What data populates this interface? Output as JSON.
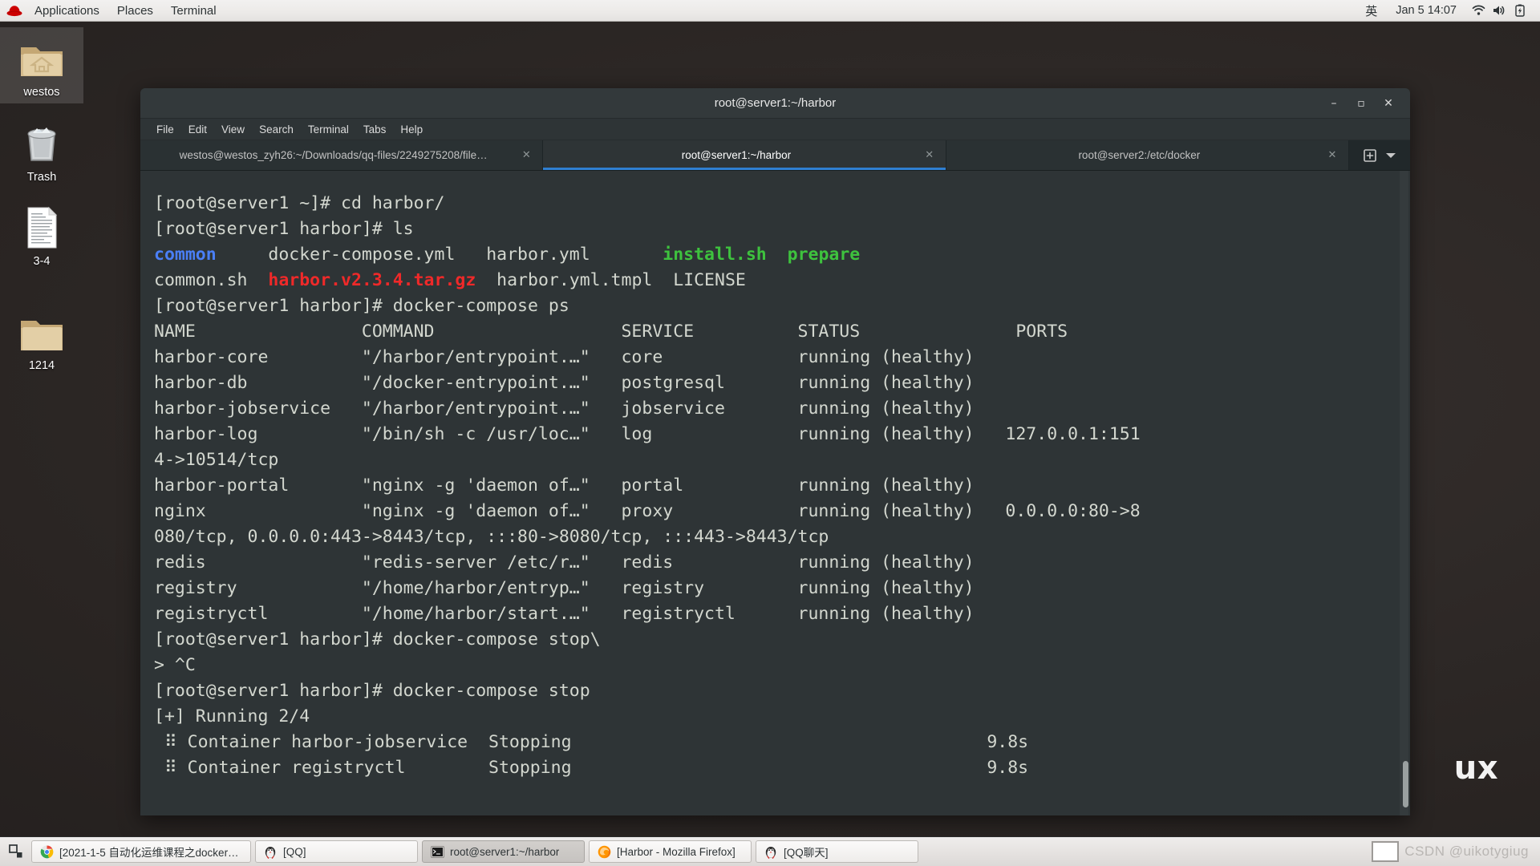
{
  "top_panel": {
    "logo_icon": "redhat-logo-icon",
    "menus": [
      "Applications",
      "Places",
      "Terminal"
    ],
    "input_method": "英",
    "clock": "Jan 5  14:07",
    "tray_icons": [
      "wifi-icon",
      "volume-icon",
      "battery-icon"
    ]
  },
  "desktop": {
    "wallpaper_text": "ux",
    "icons": [
      {
        "label": "westos",
        "icon": "home-folder-icon",
        "selected": true
      },
      {
        "label": "Trash",
        "icon": "trash-icon",
        "selected": false
      },
      {
        "label": "3-4",
        "icon": "document-icon",
        "selected": false
      },
      {
        "label": "1214",
        "icon": "folder-icon",
        "selected": false
      }
    ]
  },
  "terminal": {
    "title": "root@server1:~/harbor",
    "window_buttons": {
      "minimize": "–",
      "maximize": "▫",
      "close": "✕"
    },
    "menu": [
      "File",
      "Edit",
      "View",
      "Search",
      "Terminal",
      "Tabs",
      "Help"
    ],
    "tabs": [
      {
        "label": "westos@westos_zyh26:~/Downloads/qq-files/2249275208/file…",
        "active": false,
        "close": "✕"
      },
      {
        "label": "root@server1:~/harbor",
        "active": true,
        "close": "✕"
      },
      {
        "label": "root@server2:/etc/docker",
        "active": false,
        "close": "✕"
      }
    ],
    "tab_extras": {
      "new_tab_icon": "new-tab-icon",
      "dropdown_icon": "chevron-down-icon"
    },
    "content_lines": [
      {
        "segments": [
          {
            "text": "[root@server1 ~]# cd harbor/",
            "color": "default"
          }
        ]
      },
      {
        "segments": [
          {
            "text": "[root@server1 harbor]# ls",
            "color": "default"
          }
        ]
      },
      {
        "segments": [
          {
            "text": "common",
            "color": "blue"
          },
          {
            "text": "     docker-compose.yml   harbor.yml       ",
            "color": "default"
          },
          {
            "text": "install.sh",
            "color": "green"
          },
          {
            "text": "  ",
            "color": "default"
          },
          {
            "text": "prepare",
            "color": "green"
          }
        ]
      },
      {
        "segments": [
          {
            "text": "common.sh  ",
            "color": "default"
          },
          {
            "text": "harbor.v2.3.4.tar.gz",
            "color": "red"
          },
          {
            "text": "  harbor.yml.tmpl  LICENSE",
            "color": "default"
          }
        ]
      },
      {
        "segments": [
          {
            "text": "[root@server1 harbor]# docker-compose ps",
            "color": "default"
          }
        ]
      },
      {
        "segments": [
          {
            "text": "NAME                COMMAND                  SERVICE          STATUS               PORTS",
            "color": "default"
          }
        ]
      },
      {
        "segments": [
          {
            "text": "harbor-core         \"/harbor/entrypoint.…\"   core             running (healthy)",
            "color": "default"
          }
        ]
      },
      {
        "segments": [
          {
            "text": "harbor-db           \"/docker-entrypoint.…\"   postgresql       running (healthy)",
            "color": "default"
          }
        ]
      },
      {
        "segments": [
          {
            "text": "harbor-jobservice   \"/harbor/entrypoint.…\"   jobservice       running (healthy)",
            "color": "default"
          }
        ]
      },
      {
        "segments": [
          {
            "text": "harbor-log          \"/bin/sh -c /usr/loc…\"   log              running (healthy)   127.0.0.1:151",
            "color": "default"
          }
        ]
      },
      {
        "segments": [
          {
            "text": "4->10514/tcp",
            "color": "default"
          }
        ]
      },
      {
        "segments": [
          {
            "text": "harbor-portal       \"nginx -g 'daemon of…\"   portal           running (healthy)",
            "color": "default"
          }
        ]
      },
      {
        "segments": [
          {
            "text": "nginx               \"nginx -g 'daemon of…\"   proxy            running (healthy)   0.0.0.0:80->8",
            "color": "default"
          }
        ]
      },
      {
        "segments": [
          {
            "text": "080/tcp, 0.0.0.0:443->8443/tcp, :::80->8080/tcp, :::443->8443/tcp",
            "color": "default"
          }
        ]
      },
      {
        "segments": [
          {
            "text": "redis               \"redis-server /etc/r…\"   redis            running (healthy)",
            "color": "default"
          }
        ]
      },
      {
        "segments": [
          {
            "text": "registry            \"/home/harbor/entryp…\"   registry         running (healthy)",
            "color": "default"
          }
        ]
      },
      {
        "segments": [
          {
            "text": "registryctl         \"/home/harbor/start.…\"   registryctl      running (healthy)",
            "color": "default"
          }
        ]
      },
      {
        "segments": [
          {
            "text": "[root@server1 harbor]# docker-compose stop\\",
            "color": "default"
          }
        ]
      },
      {
        "segments": [
          {
            "text": "> ^C",
            "color": "default"
          }
        ]
      },
      {
        "segments": [
          {
            "text": "[root@server1 harbor]# docker-compose stop",
            "color": "default"
          }
        ]
      },
      {
        "segments": [
          {
            "text": "[+] Running 2/4",
            "color": "default"
          }
        ]
      },
      {
        "segments": [
          {
            "text": " ⠿ Container harbor-jobservice  Stopping                                        9.8s",
            "color": "default"
          }
        ]
      },
      {
        "segments": [
          {
            "text": " ⠿ Container registryctl        Stopping                                        9.8s",
            "color": "default"
          }
        ]
      }
    ]
  },
  "taskbar": {
    "show_desktop_icon": "show-desktop-icon",
    "buttons": [
      {
        "label": "[2021-1-5 自动化运维课程之docker…",
        "icon": "chrome-icon",
        "active": false
      },
      {
        "label": "[QQ]",
        "icon": "qq-penguin-icon",
        "active": false
      },
      {
        "label": "root@server1:~/harbor",
        "icon": "terminal-icon",
        "active": true
      },
      {
        "label": "[Harbor - Mozilla Firefox]",
        "icon": "firefox-icon",
        "active": false
      },
      {
        "label": "[QQ聊天]",
        "icon": "qq-penguin-icon",
        "active": false
      }
    ],
    "tray": {
      "box_icon": "white-box-icon",
      "watermark": "CSDN @uikotygiug"
    }
  },
  "colors": {
    "terminal_bg": "#2e3436",
    "tab_active_underline": "#2f7fd1",
    "dir_blue": "#4a7ff7",
    "exec_green": "#3ec23e",
    "archive_red": "#ef2929"
  }
}
